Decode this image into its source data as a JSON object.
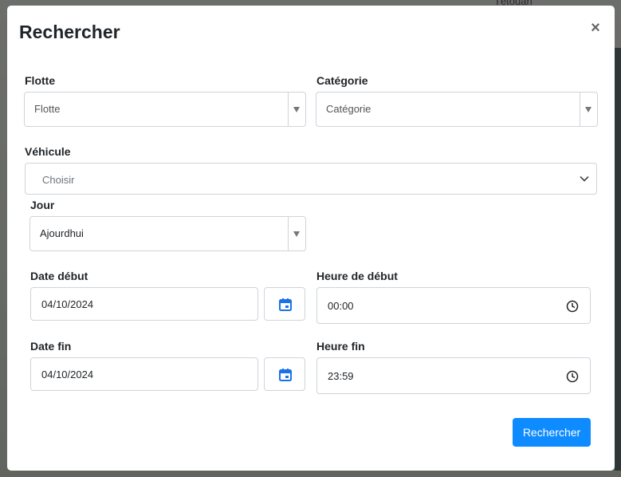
{
  "background": {
    "map_label": "Tétouan"
  },
  "modal": {
    "title": "Rechercher",
    "close_label": "×"
  },
  "form": {
    "flotte": {
      "label": "Flotte",
      "value": "Flotte"
    },
    "categorie": {
      "label": "Catégorie",
      "value": "Catégorie"
    },
    "vehicule": {
      "label": "Véhicule",
      "placeholder": "Choisir"
    },
    "jour": {
      "label": "Jour",
      "value": "Ajourdhui"
    },
    "date_debut": {
      "label": "Date début",
      "value": "04/10/2024"
    },
    "heure_debut": {
      "label": "Heure de début",
      "value": "00:00"
    },
    "date_fin": {
      "label": "Date fin",
      "value": "04/10/2024"
    },
    "heure_fin": {
      "label": "Heure fin",
      "value": "23:59"
    },
    "submit_label": "Rechercher"
  },
  "colors": {
    "primary": "#0d8bff",
    "calendar_icon": "#1a73e8"
  },
  "icons": [
    "close-icon",
    "caret-down-icon",
    "chevron-down-icon",
    "calendar-icon",
    "clock-icon"
  ]
}
